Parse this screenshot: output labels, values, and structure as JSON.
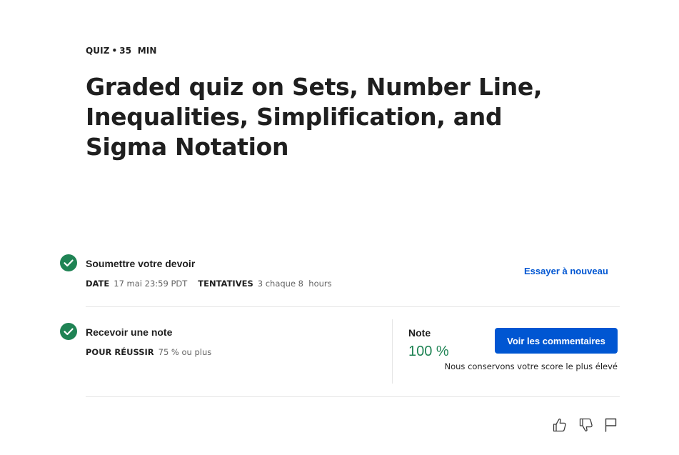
{
  "header": {
    "type_label": "QUIZ",
    "separator": "•",
    "duration_number": "35",
    "duration_unit": "MIN",
    "title": "Graded quiz on Sets, Number Line, Inequalities, Simplification, and Sigma Notation"
  },
  "submit_step": {
    "title": "Soumettre votre devoir",
    "due_label": "DATE",
    "due_value": "17 mai 23:59 PDT",
    "attempts_label": "TENTATIVES",
    "attempts_value": "3 chaque 8  hours",
    "retry_label": "Essayer à nouveau",
    "status_icon": "check-circle-icon"
  },
  "grade_step": {
    "title": "Recevoir une note",
    "pass_label": "POUR RÉUSSIR",
    "pass_value": "75 % ou plus",
    "grade_label": "Note",
    "grade_value": "100 %",
    "feedback_button": "Voir les commentaires",
    "keep_note": "Nous conservons votre score le plus élevé",
    "status_icon": "check-circle-icon"
  },
  "footer_actions": {
    "icons": [
      "thumbs-up-icon",
      "thumbs-down-icon",
      "flag-icon"
    ]
  },
  "colors": {
    "accent_blue": "#0056d2",
    "success_green": "#1f8354",
    "text_dark": "#1f1f1f",
    "text_muted": "#636363",
    "divider": "#e5e5e5"
  }
}
